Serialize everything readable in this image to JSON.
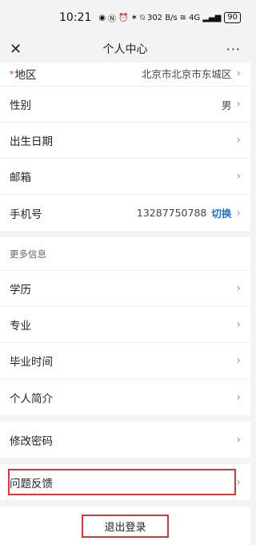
{
  "status": {
    "time": "10:21",
    "speed": "302 B/s",
    "network": "4G",
    "battery": "90"
  },
  "nav": {
    "title": "个人中心",
    "close_icon": "✕",
    "more_icon": "···"
  },
  "basic": [
    {
      "label": "地区",
      "value": "北京市北京市东城区",
      "required": true
    },
    {
      "label": "性别",
      "value": "男"
    },
    {
      "label": "出生日期",
      "value": ""
    },
    {
      "label": "邮箱",
      "value": ""
    },
    {
      "label": "手机号",
      "value": "13287750788",
      "action": "切换"
    }
  ],
  "more": {
    "header": "更多信息",
    "items": [
      {
        "label": "学历"
      },
      {
        "label": "专业"
      },
      {
        "label": "毕业时间"
      },
      {
        "label": "个人简介"
      }
    ]
  },
  "password": {
    "label": "修改密码"
  },
  "feedback": {
    "label": "问题反馈"
  },
  "logout": {
    "label": "退出登录"
  },
  "colors": {
    "accent": "#1a6fd6",
    "highlight": "#d8383a",
    "required": "#d93025"
  }
}
